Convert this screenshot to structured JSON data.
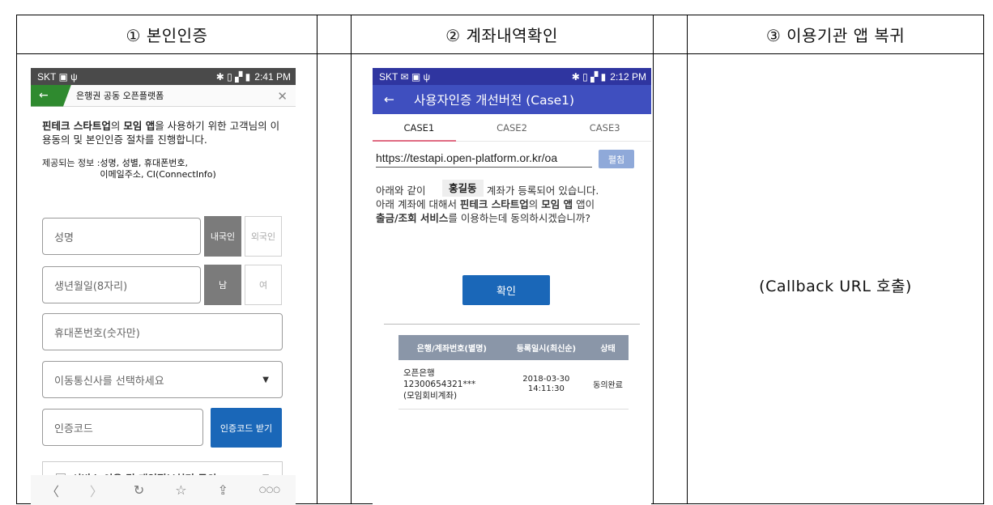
{
  "headers": [
    "① 본인인증",
    "② 계좌내역확인",
    "③ 이용기관 앱 복귀"
  ],
  "step3_text": "(Callback URL 호출)",
  "phone1": {
    "status": {
      "carrier": "SKT",
      "time": "2:41 PM"
    },
    "app_title": "은행권 공동 오픈플랫폼",
    "intro": {
      "b1": "핀테크 스타트업",
      "t1": "의 ",
      "b2": "모임 앱",
      "t2": "을 사용하기 위한 고객님의 이용동의 및 본인인증 절차를 진행합니다."
    },
    "info_label": "제공되는 정보 : ",
    "info_value_line1": "성명, 성별, 휴대폰번호,",
    "info_value_line2": "이메일주소, CI(ConnectInfo)",
    "name_placeholder": "성명",
    "domestic": "내국인",
    "foreign": "외국인",
    "birth_placeholder": "생년월일(8자리)",
    "male": "남",
    "female": "여",
    "phone_placeholder": "휴대폰번호(숫자만)",
    "carrier_select": "이동통신사를 선택하세요",
    "code_placeholder": "인증코드",
    "get_code": "인증코드 받기",
    "consent": "서비스 이용 및 개인정보처리 동의"
  },
  "phone2": {
    "status": {
      "carrier": "SKT",
      "time": "2:12 PM"
    },
    "title": "사용자인증 개선버전 (Case1)",
    "tabs": [
      "CASE1",
      "CASE2",
      "CASE3"
    ],
    "url": "https://testapi.open-platform.or.kr/oa",
    "expand": "펼침",
    "name": "홍길동",
    "msg1a": "아래와 같이 ",
    "msg1b": "님 계좌가 등록되어 있습니다.",
    "msg2": "아래 계좌에 대해서 ",
    "msg2b": "핀테크 스타트업",
    "msg2c": "의 ",
    "msg2d": "모임 앱",
    "msg2e": " 앱이",
    "msg3b": "출금/조회 서비스",
    "msg3c": "를 이용하는데 동의하시겠습니까?",
    "confirm": "확인",
    "table": {
      "headers": [
        "은행/계좌번호(별명)",
        "등록일시(최신순)",
        "상태"
      ],
      "row": {
        "bank": "오픈은행",
        "account": "12300654321***",
        "alias": "(모임회비계좌)",
        "date": "2018-03-30",
        "time": "14:11:30",
        "status": "동의완료"
      }
    }
  }
}
